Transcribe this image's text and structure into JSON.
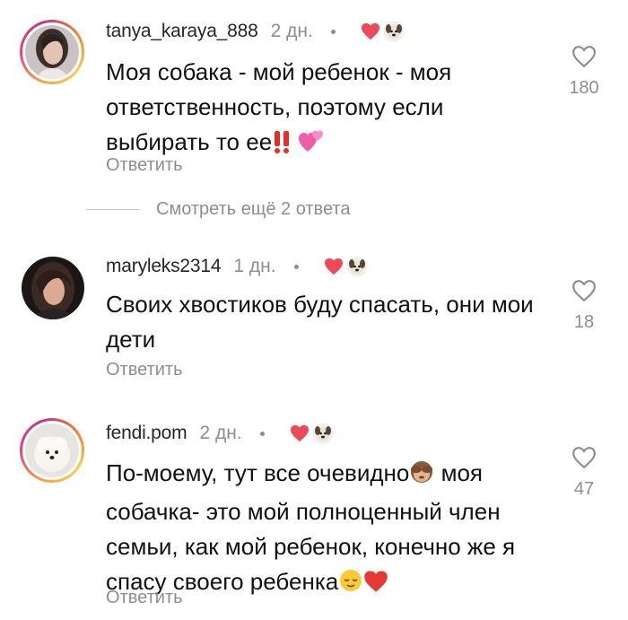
{
  "comments": [
    {
      "username": "tanya_karaya_888",
      "time": "2 дн.",
      "text": "Моя собака - мой ребенок - моя ответственность, поэтому если выбирать то ее",
      "emojis": [
        "double-exclamation-emoji",
        "two-hearts-emoji"
      ],
      "reply_label": "Ответить",
      "likes": "180",
      "avatar_ring": true
    },
    {
      "username": "maryleks2314",
      "time": "1 дн.",
      "text": "Своих хвостиков буду спасать, они мои дети",
      "emojis": [],
      "reply_label": "Ответить",
      "likes": "18",
      "avatar_ring": false
    },
    {
      "username": "fendi.pom",
      "time": "2 дн.",
      "text": "По-моему, тут все очевидно",
      "text_after_emoji": " моя собачка- это мой полноценный член семьи, как мой ребенок, конечно же я спасу своего ребенка",
      "emojis": [
        "see-no-evil-monkey-emoji",
        "relieved-face-emoji",
        "red-heart-emoji"
      ],
      "reply_label": "Ответить",
      "likes": "47",
      "avatar_ring": true
    }
  ],
  "view_replies": "Смотреть ещё 2 ответа",
  "colors": {
    "secondary_text": "#8e8e8e",
    "heart_red": "#ed4956"
  },
  "icons": {
    "like": "heart-outline-icon",
    "creator_like": "heart-filled-icon",
    "creator_avatar": "dog-avatar-icon"
  }
}
